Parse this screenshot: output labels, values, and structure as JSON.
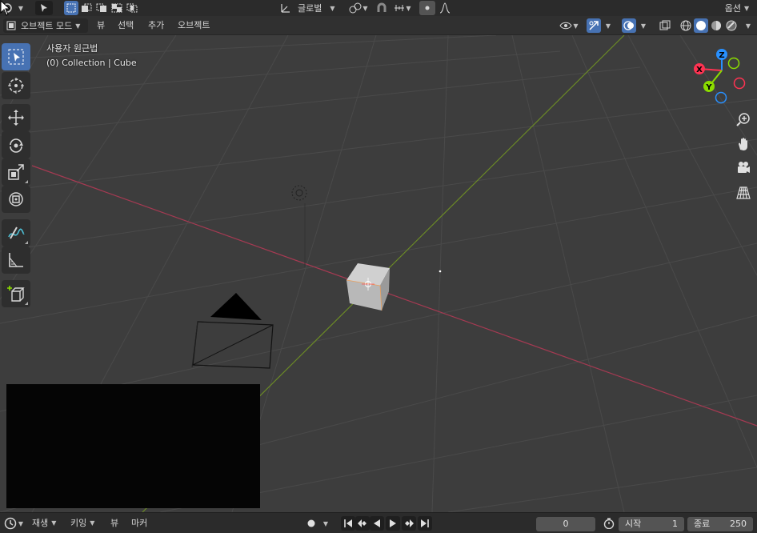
{
  "topbar": {
    "orientation_label": "글로벌",
    "options_label": "옵션"
  },
  "header": {
    "mode_label": "오브젝트 모드",
    "menus": [
      "뷰",
      "선택",
      "추가",
      "오브젝트"
    ]
  },
  "viewport": {
    "view_name": "사용자 원근법",
    "collection_info": "(0) Collection | Cube"
  },
  "gizmo": {
    "x_label": "X",
    "y_label": "Y",
    "z_label": "Z",
    "colors": {
      "x": "#ff3352",
      "y": "#8bdc00",
      "z": "#2890ff"
    }
  },
  "tools": [
    {
      "name": "select-box-icon"
    },
    {
      "name": "cursor-icon"
    },
    {
      "name": "move-icon"
    },
    {
      "name": "rotate-icon"
    },
    {
      "name": "scale-icon"
    },
    {
      "name": "transform-icon"
    },
    {
      "name": "annotate-icon"
    },
    {
      "name": "measure-icon"
    },
    {
      "name": "add-cube-icon"
    }
  ],
  "timeline": {
    "menus": [
      "재생",
      "키잉",
      "뷰",
      "마커"
    ],
    "current_frame": "0",
    "start_label": "시작",
    "start_value": "1",
    "end_label": "종료",
    "end_value": "250"
  },
  "colors": {
    "accent": "#4772b3",
    "x_axis_line": "#a43a52",
    "y_axis_line": "#6b8a26",
    "viewport_bg": "#3d3d3d"
  }
}
